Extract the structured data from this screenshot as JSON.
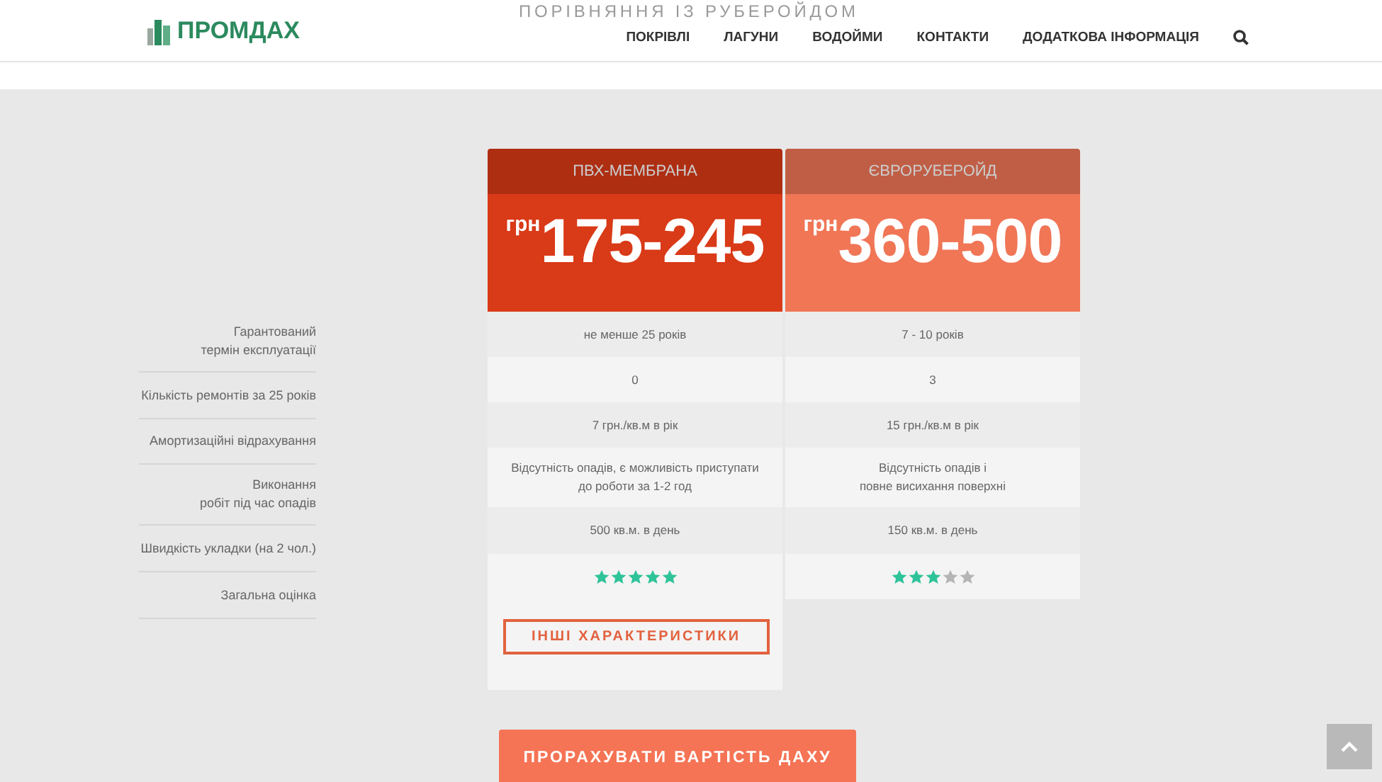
{
  "header": {
    "logo": "ПРОМДАХ",
    "faded_title": "ПОРІВНЯННЯ ІЗ РУБЕРОЙДОМ",
    "nav": [
      "ПОКРІВЛІ",
      "ЛАГУНИ",
      "ВОДОЙМИ",
      "КОНТАКТИ",
      "ДОДАТКОВА ІНФОРМАЦІЯ"
    ]
  },
  "criteria": [
    {
      "lines": [
        "Гарантований",
        "термін експлуатації"
      ]
    },
    {
      "lines": [
        "Кількість ремонтів за 25 років"
      ]
    },
    {
      "lines": [
        "Амортизаційні відрахування"
      ]
    },
    {
      "lines": [
        "Виконання",
        "робіт під час опадів"
      ]
    },
    {
      "lines": [
        "Швидкість укладки (на 2 чол.)"
      ]
    },
    {
      "lines": [
        "Загальна оцінка"
      ]
    }
  ],
  "columns": [
    {
      "name": "ПВХ-МЕМБРАНА",
      "color": "#d93a17",
      "currency": "грн",
      "price": "175-245",
      "values": [
        [
          "не менше 25 років"
        ],
        [
          "0"
        ],
        [
          "7 грн./кв.м в рік"
        ],
        [
          "Відсутність опадів, є можливість приступати",
          "до роботи за 1-2 год"
        ],
        [
          "500 кв.м. в день"
        ]
      ],
      "stars": 5,
      "button": "ІНШІ ХАРАКТЕРИСТИКИ"
    },
    {
      "name": "ЄВРОРУБЕРОЙД",
      "color": "#f07656",
      "currency": "грн",
      "price": "360-500",
      "values": [
        [
          "7 - 10 років"
        ],
        [
          "3"
        ],
        [
          "15 грн./кв.м в рік"
        ],
        [
          "Відсутність опадів і",
          "повне висихання поверхні"
        ],
        [
          "150 кв.м. в день"
        ]
      ],
      "stars": 3
    }
  ],
  "cta": "ПРОРАХУВАТИ ВАРТІСТЬ ДАХУ"
}
